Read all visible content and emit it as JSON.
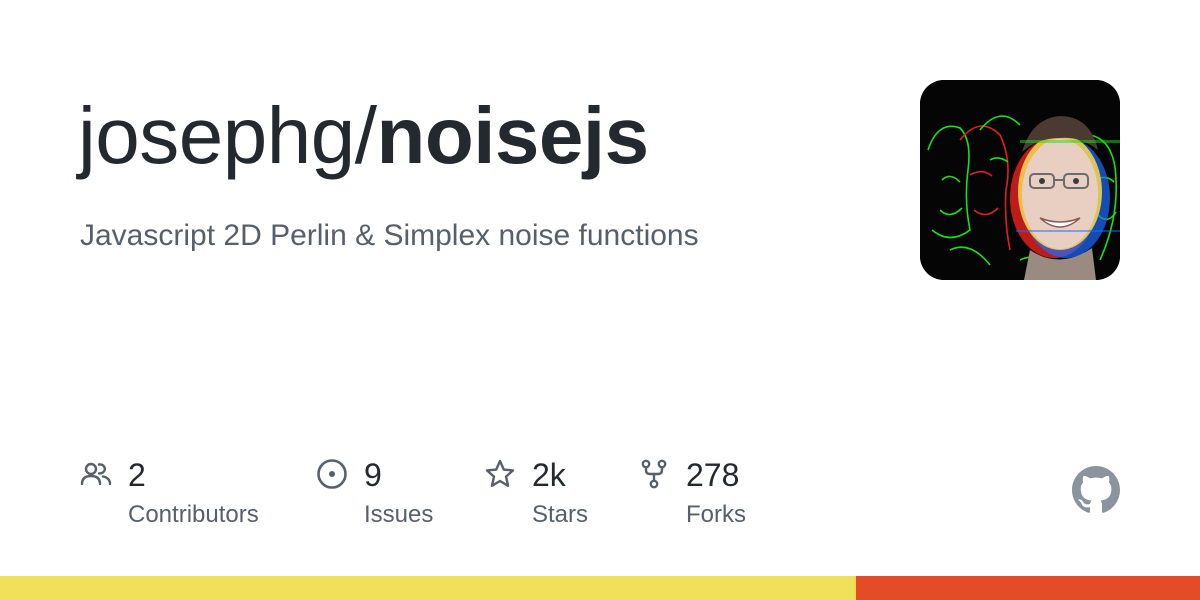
{
  "repo": {
    "owner": "josephg/",
    "name": "noisejs",
    "description": "Javascript 2D Perlin & Simplex noise functions"
  },
  "stats": [
    {
      "icon": "contributors-icon",
      "value": "2",
      "label": "Contributors"
    },
    {
      "icon": "issues-icon",
      "value": "9",
      "label": "Issues"
    },
    {
      "icon": "star-icon",
      "value": "2k",
      "label": "Stars"
    },
    {
      "icon": "fork-icon",
      "value": "278",
      "label": "Forks"
    }
  ],
  "language_bar": [
    {
      "color": "#f1e05a",
      "share": 0.713
    },
    {
      "color": "#e34c26",
      "share": 0.287
    }
  ],
  "colors": {
    "title": "#24292f",
    "muted": "#57606a",
    "icon": "#57606a"
  }
}
